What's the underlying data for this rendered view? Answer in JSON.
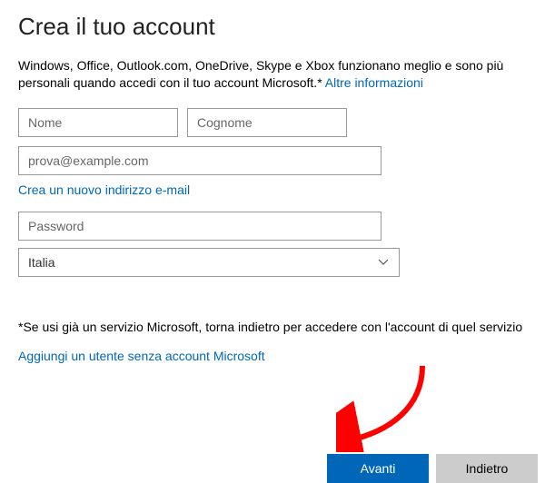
{
  "title": "Crea il tuo account",
  "intro": {
    "text": "Windows, Office, Outlook.com, OneDrive, Skype e Xbox funzionano meglio e sono più personali quando accedi con il tuo account Microsoft.* ",
    "more_link": "Altre informazioni"
  },
  "form": {
    "first_name_placeholder": "Nome",
    "last_name_placeholder": "Cognome",
    "email_placeholder": "prova@example.com",
    "create_new_email_link": "Crea un nuovo indirizzo e-mail",
    "password_placeholder": "Password",
    "country_selected": "Italia"
  },
  "footnote": "*Se usi già un servizio Microsoft, torna indietro per accedere con l'account di quel servizio",
  "add_user_link": "Aggiungi un utente senza account Microsoft",
  "buttons": {
    "next": "Avanti",
    "back": "Indietro"
  },
  "colors": {
    "accent": "#0067b8"
  }
}
